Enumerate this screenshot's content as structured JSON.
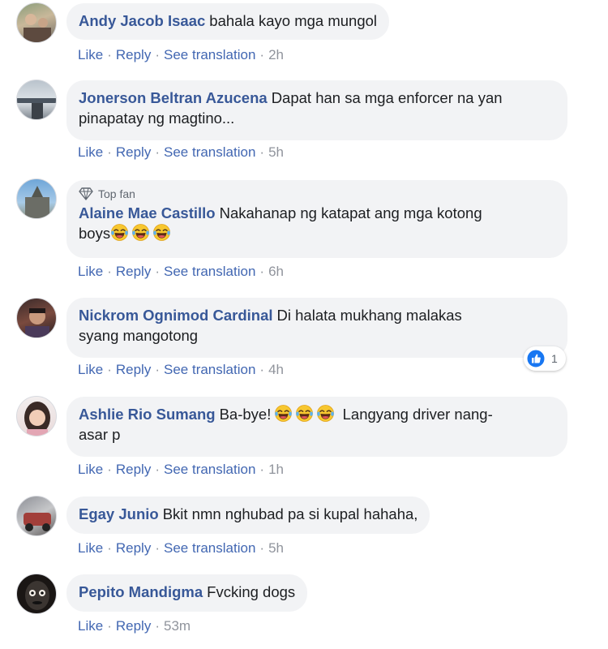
{
  "action_labels": {
    "like": "Like",
    "reply": "Reply",
    "see_translation": "See translation",
    "separator": "·"
  },
  "comments": [
    {
      "author": "Andy Jacob Isaac",
      "text": "bahala kayo mga mungol",
      "time": "2h"
    },
    {
      "author": "Jonerson Beltran Azucena",
      "text": "Dapat han sa mga enforcer na yan",
      "text2": "pinapatay ng magtino...",
      "time": "5h"
    },
    {
      "badge": "Top fan",
      "author": "Alaine Mae Castillo",
      "text": "Nakahanap ng katapat ang mga kotong",
      "text2": "boys",
      "time": "6h"
    },
    {
      "author": "Nickrom Ognimod Cardinal",
      "text": "Di halata mukhang malakas",
      "text2": "syang mangotong",
      "time": "4h",
      "reaction_count": "1"
    },
    {
      "author": "Ashlie Rio Sumang",
      "text": "Ba-bye!",
      "text_after_emoji": "Langyang driver nang-",
      "text2": "asar p",
      "time": "1h"
    },
    {
      "author": "Egay Junio",
      "text": "Bkit nmn nghubad pa si kupal hahaha,",
      "time": "5h"
    },
    {
      "author": "Pepito Mandigma",
      "text": "Fvcking dogs",
      "time": "53m"
    }
  ],
  "colors": {
    "link": "#385898",
    "action": "#4267b2",
    "bubble": "#f2f3f5",
    "meta": "#90949c",
    "like_reaction": "#1877f2"
  },
  "icons": {
    "top_fan": "diamond-icon",
    "emoji": "laughing-tears-emoji",
    "reaction": "like-thumb-icon"
  }
}
